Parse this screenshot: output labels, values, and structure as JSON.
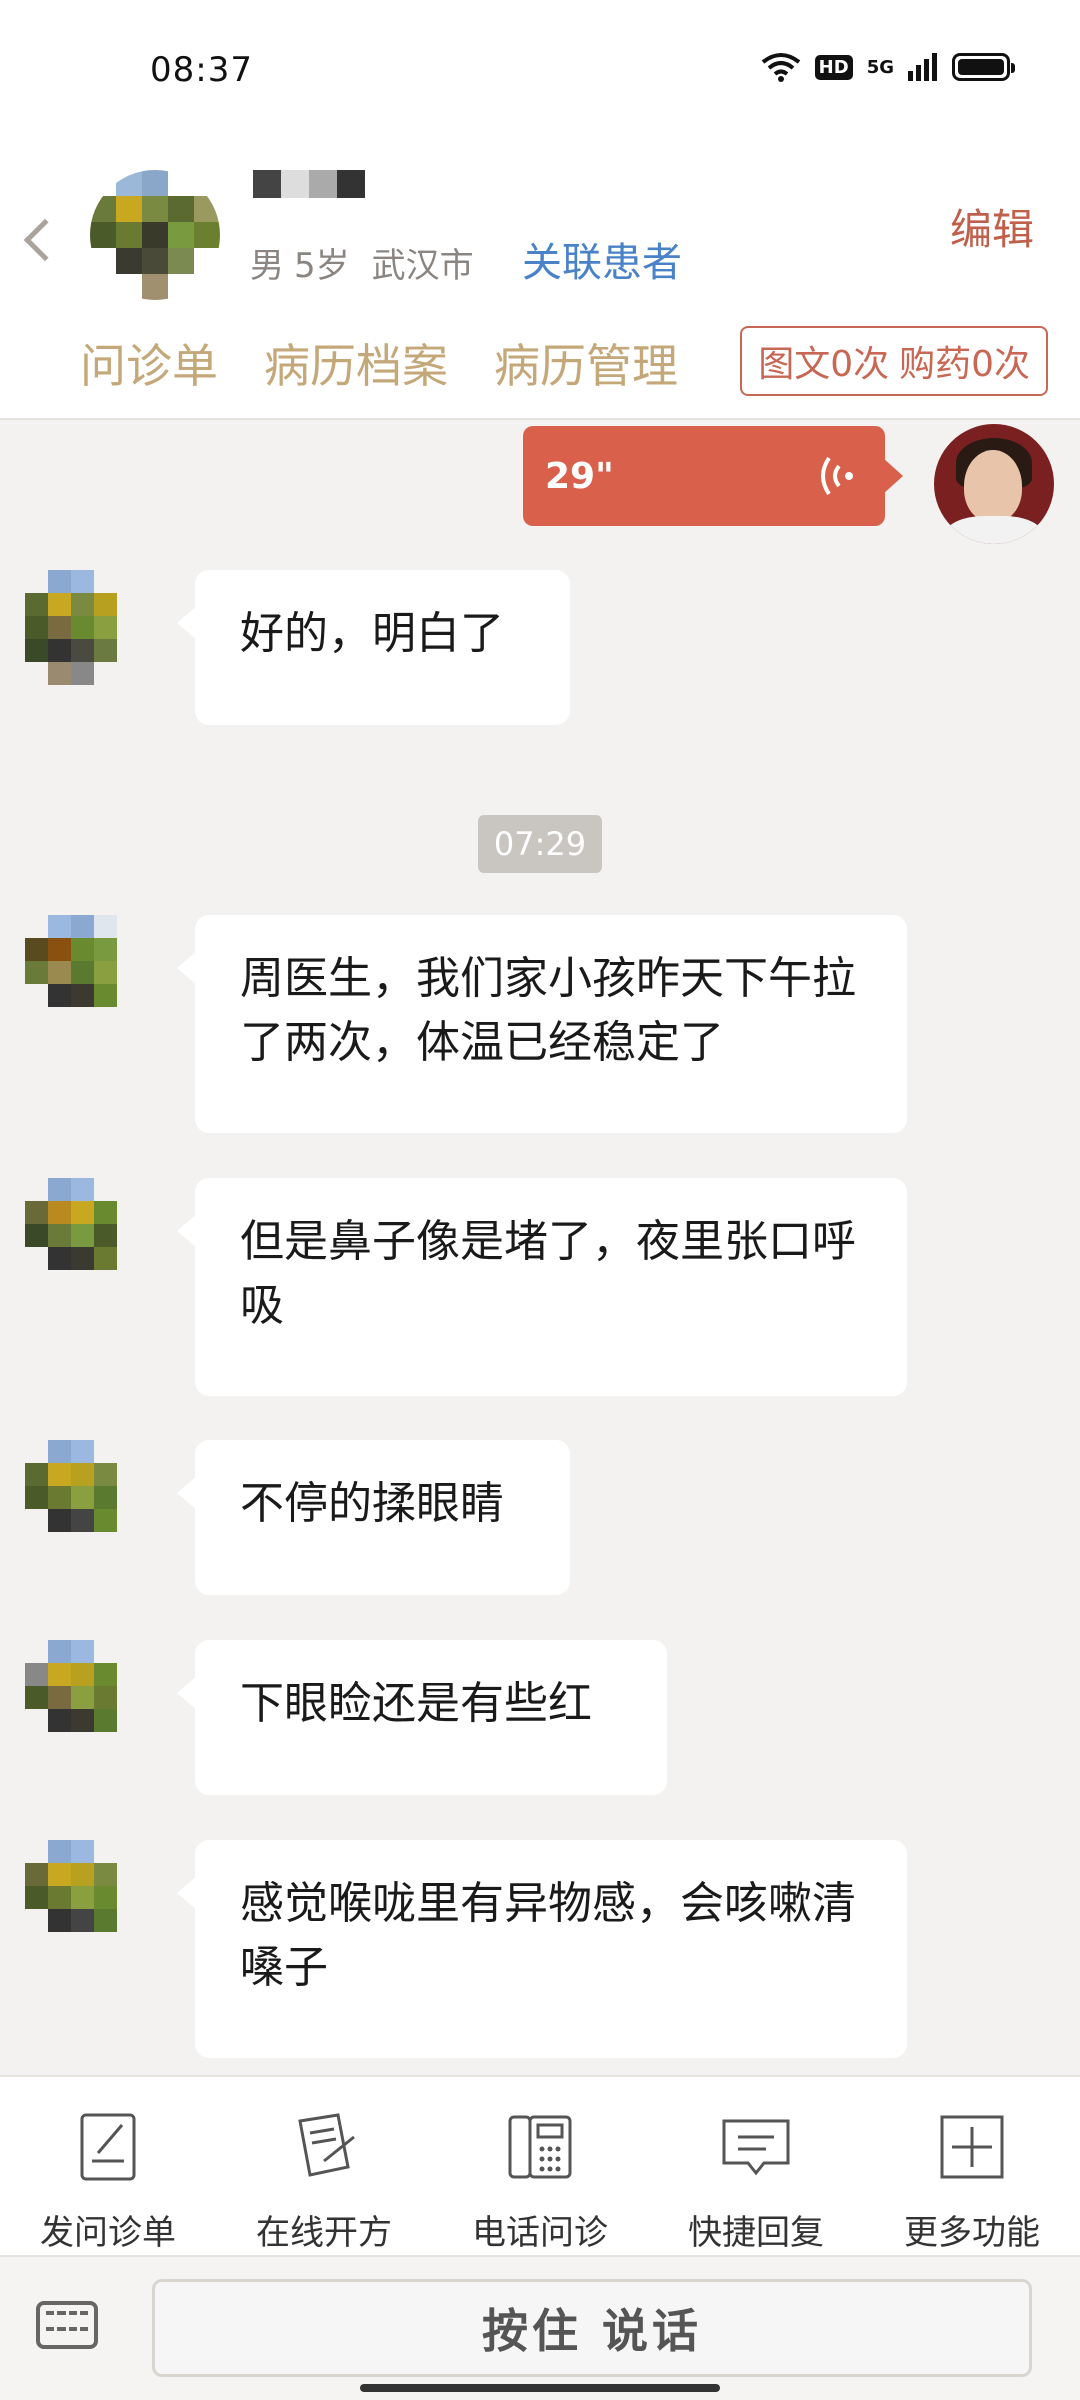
{
  "status_bar": {
    "time": "08:37",
    "hd_label": "HD",
    "network_label": "5G"
  },
  "header": {
    "patient_meta": {
      "gender": "男",
      "age": "5岁",
      "city": "武汉市"
    },
    "link_patient": "关联患者",
    "edit_label": "编辑",
    "tabs": [
      {
        "label": "问诊单"
      },
      {
        "label": "病历档案"
      },
      {
        "label": "病历管理"
      }
    ],
    "counter": {
      "graphic": "图文0次",
      "purchase": "购药0次"
    }
  },
  "chat": {
    "voice_message": {
      "duration": "29\""
    },
    "messages": [
      {
        "text": "好的，明白了"
      },
      {
        "text": "周医生，我们家小孩昨天下午拉了两次，体温已经稳定了"
      },
      {
        "text": "但是鼻子像是堵了，夜里张口呼吸"
      },
      {
        "text": "不停的揉眼睛"
      },
      {
        "text": "下眼睑还是有些红"
      },
      {
        "text": "感觉喉咙里有异物感，会咳嗽清嗓子"
      }
    ],
    "timestamp": "07:29"
  },
  "toolbar": {
    "items": [
      {
        "label": "发问诊单",
        "icon": "form-pen-icon"
      },
      {
        "label": "在线开方",
        "icon": "prescription-icon"
      },
      {
        "label": "电话问诊",
        "icon": "phone-icon"
      },
      {
        "label": "快捷回复",
        "icon": "chat-bubble-icon"
      },
      {
        "label": "更多功能",
        "icon": "plus-box-icon"
      }
    ]
  },
  "input_bar": {
    "hold_to_talk": "按住 说话"
  },
  "colors": {
    "accent_red": "#d9604a",
    "tab_gold": "#c4a879",
    "link_blue": "#4a82c8",
    "edit_red": "#c0604c"
  }
}
